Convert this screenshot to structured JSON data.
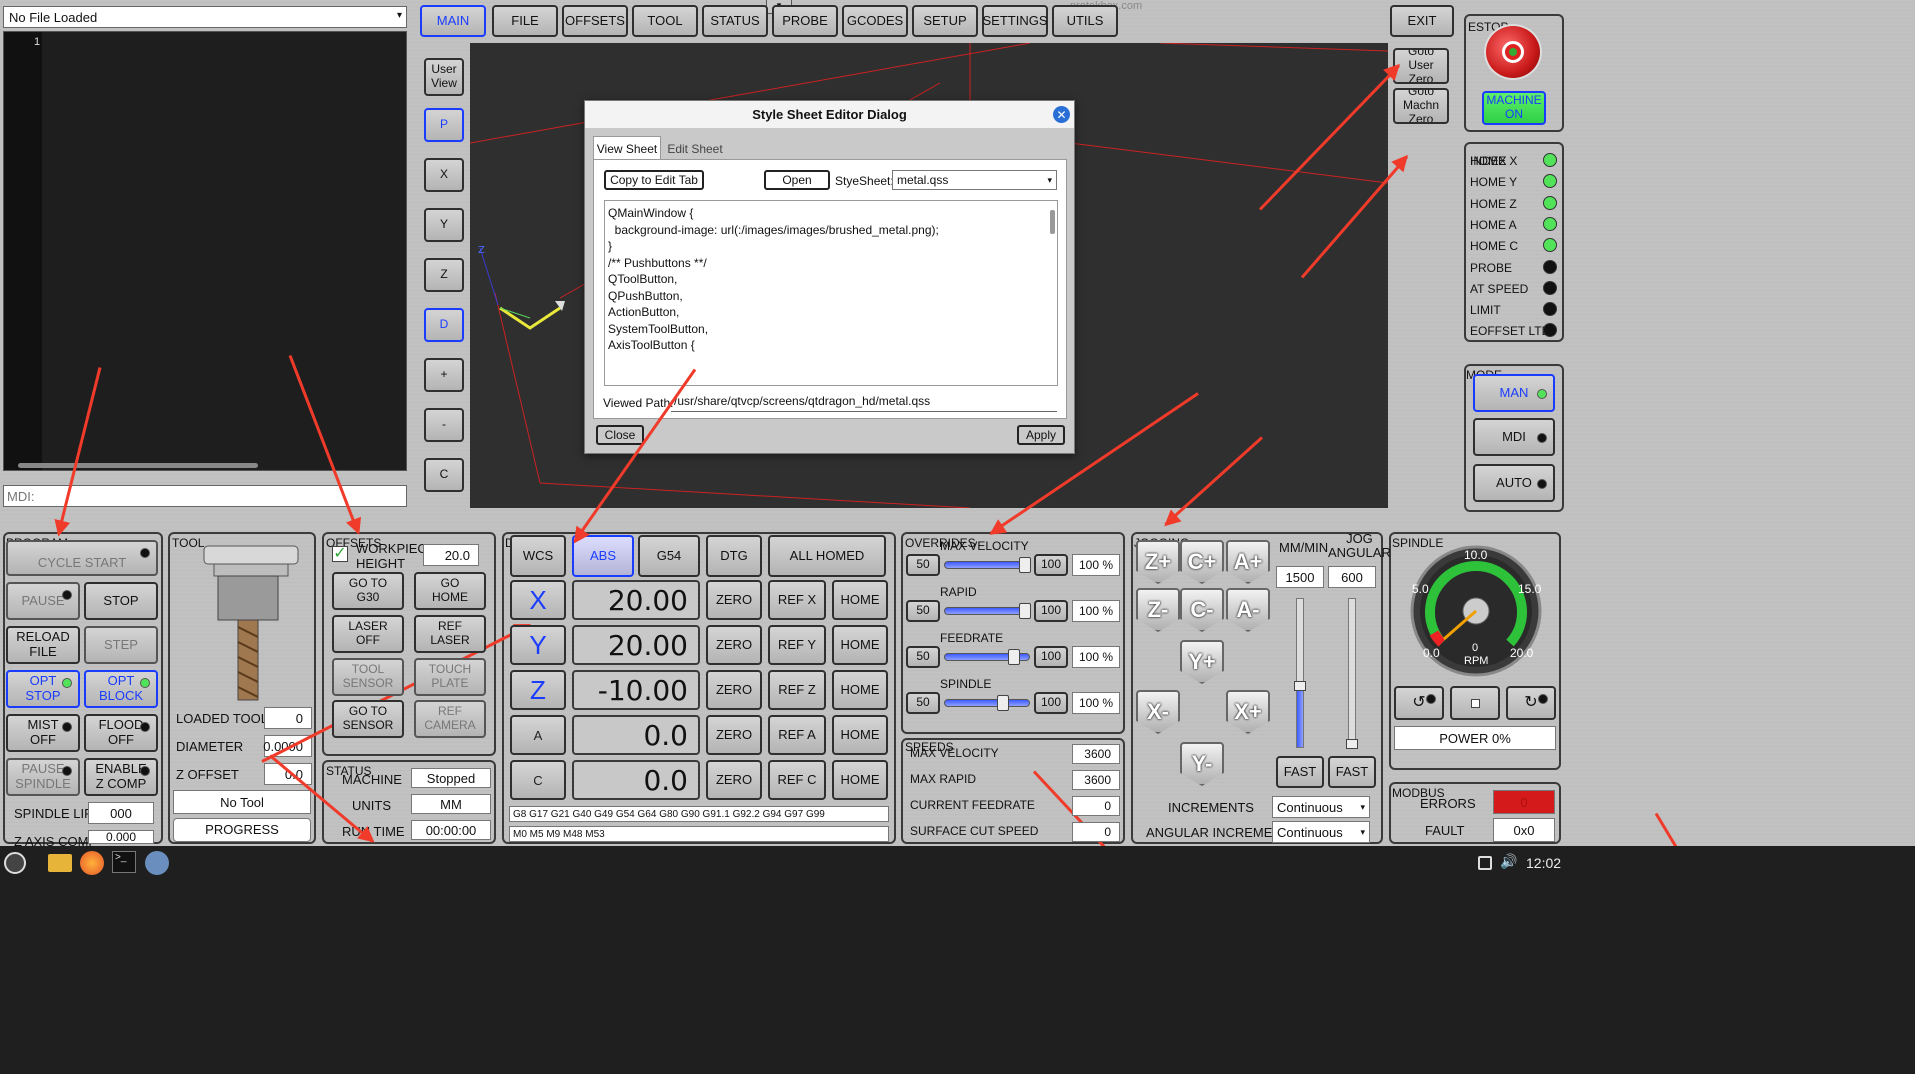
{
  "file_selector": {
    "value": "No File Loaded"
  },
  "editor": {
    "line_number": "1"
  },
  "mdi": {
    "placeholder": "MDI:"
  },
  "tabs": [
    "MAIN",
    "FILE",
    "OFFSETS",
    "TOOL",
    "STATUS",
    "PROBE",
    "GCODES",
    "SETUP",
    "SETTINGS",
    "UTILS"
  ],
  "exit_label": "EXIT",
  "view_buttons": [
    "User\nView",
    "P",
    "X",
    "Y",
    "Z",
    "D",
    "+",
    "-",
    "C"
  ],
  "goto_buttons": [
    "Goto\nUser\nZero",
    "Goto\nMachn\nZero"
  ],
  "watermark": "protekbox.com",
  "dialog": {
    "title": "Style Sheet Editor Dialog",
    "tabs": [
      "View Sheet",
      "Edit Sheet"
    ],
    "copy_button": "Copy to Edit Tab",
    "open_button": "Open",
    "stylesheet_label": "StyeSheet:",
    "stylesheet_value": "metal.qss",
    "code_lines": [
      "QMainWindow {",
      "  background-image: url(:/images/images/brushed_metal.png);",
      "}",
      "",
      "",
      "/** Pushbuttons **/",
      "QToolButton,",
      "QPushButton,",
      "ActionButton,",
      "SystemToolButton,",
      "AxisToolButton {"
    ],
    "path_label": "Viewed Path:",
    "path_value": "/usr/share/qtvcp/screens/qtdragon_hd/metal.qss",
    "close_button": "Close",
    "apply_button": "Apply"
  },
  "estop": {
    "title": "ESTOP",
    "machine_on": "MACHINE\nON"
  },
  "homing": [
    {
      "label": "HOME X",
      "on": true
    },
    {
      "label": "HOME Y",
      "on": true
    },
    {
      "label": "HOME Z",
      "on": true
    },
    {
      "label": "HOME A",
      "on": true
    },
    {
      "label": "HOME C",
      "on": true
    },
    {
      "label": "PROBE",
      "on": false
    },
    {
      "label": "AT SPEED",
      "on": false
    },
    {
      "label": "LIMIT",
      "on": false
    },
    {
      "label": "EOFFSET LTD",
      "on": false
    }
  ],
  "homing_overlap": "INDEX",
  "mode": {
    "title": "MODE",
    "buttons": [
      "MAN",
      "MDI",
      "AUTO"
    ]
  },
  "program": {
    "title": "PROGRAM",
    "cycle_start": "CYCLE START",
    "pause": "PAUSE",
    "stop": "STOP",
    "reload": "RELOAD\nFILE",
    "step": "STEP",
    "opt_stop": "OPT\nSTOP",
    "opt_block": "OPT\nBLOCK",
    "mist": "MIST\nOFF",
    "flood": "FLOOD\nOFF",
    "pause_spindle": "PAUSE\nSPINDLE",
    "enable_zcomp": "ENABLE\nZ COMP",
    "spindle_lift_label": "SPINDLE LIFT",
    "spindle_lift_value": "000",
    "zaxis_comp_label": "Z AXIS COMP",
    "zaxis_comp_value": "0.000"
  },
  "tool": {
    "title": "TOOL",
    "loaded_tool_label": "LOADED TOOL",
    "loaded_tool_value": "0",
    "diameter_label": "DIAMETER",
    "diameter_value": "0.0000",
    "zoffset_label": "Z OFFSET",
    "zoffset_value": "0.0",
    "tool_name": "No Tool",
    "progress": "PROGRESS"
  },
  "offsets": {
    "title": "OFFSETS",
    "workpiece_label": "WORKPIECE\nHEIGHT",
    "workpiece_value": "20.0",
    "buttons": [
      "GO TO\nG30",
      "GO\nHOME",
      "LASER\nOFF",
      "REF\nLASER",
      "TOOL\nSENSOR",
      "TOUCH\nPLATE",
      "GO TO\nSENSOR",
      "REF\nCAMERA"
    ]
  },
  "status": {
    "title": "STATUS",
    "machine_label": "MACHINE",
    "machine_value": "Stopped",
    "units_label": "UNITS",
    "units_value": "MM",
    "runtime_label": "RUN TIME",
    "runtime_value": "00:00:00"
  },
  "dro": {
    "title": "DRO",
    "wcs": "WCS",
    "abs": "ABS",
    "g54": "G54",
    "dtg": "DTG",
    "all_homed": "ALL HOMED",
    "axes": [
      {
        "axis": "X",
        "value": "20.00",
        "ref": "REF X"
      },
      {
        "axis": "Y",
        "value": "20.00",
        "ref": "REF Y"
      },
      {
        "axis": "Z",
        "value": "-10.00",
        "ref": "REF Z"
      },
      {
        "axis": "A",
        "value": "0.0",
        "ref": "REF A"
      },
      {
        "axis": "C",
        "value": "0.0",
        "ref": "REF C"
      }
    ],
    "zero": "ZERO",
    "home": "HOME",
    "gcodes": "G8 G17 G21 G40 G49 G54 G64 G80 G90 G91.1 G92.2 G94 G97 G99",
    "mcodes": "M0 M5 M9 M48 M53"
  },
  "overrides": {
    "title": "OVERRIDES",
    "rows": [
      {
        "label": "MAX VELOCITY",
        "min": "50",
        "max": "100",
        "value": "100 %",
        "level": 1.0
      },
      {
        "label": "RAPID",
        "min": "50",
        "max": "100",
        "value": "100 %",
        "level": 1.0
      },
      {
        "label": "FEEDRATE",
        "min": "50",
        "max": "100",
        "value": "100 %",
        "level": 0.85
      },
      {
        "label": "SPINDLE",
        "min": "50",
        "max": "100",
        "value": "100 %",
        "level": 0.7
      }
    ]
  },
  "speeds": {
    "title": "SPEEDS",
    "rows": [
      {
        "label": "MAX VELOCITY",
        "value": "3600"
      },
      {
        "label": "MAX RAPID",
        "value": "3600"
      },
      {
        "label": "CURRENT FEEDRATE",
        "value": "0"
      },
      {
        "label": "SURFACE CUT SPEED",
        "value": "0"
      }
    ]
  },
  "jogging": {
    "title": "JOGGING",
    "buttons": [
      "Z+",
      "C+",
      "A+",
      "Z-",
      "C-",
      "A-",
      "Y+",
      "X-",
      "X+",
      "Y-"
    ],
    "mm_min_label": "MM/MIN",
    "jog_angular_label": "JOG\nANGULAR",
    "mm_min_value": "1500",
    "angular_value": "600",
    "fast": "FAST",
    "increments_label": "INCREMENTS",
    "increments_value": "Continuous",
    "angular_inc_label": "ANGULAR INCREMENT",
    "angular_inc_value": "Continuous"
  },
  "spindle": {
    "title": "SPINDLE",
    "gauge_labels": [
      "0.0",
      "5.0",
      "10.0",
      "15.0",
      "20.0"
    ],
    "rpm_value": "0",
    "rpm_label": "RPM",
    "power": "POWER 0%"
  },
  "modbus": {
    "title": "MODBUS",
    "errors_label": "ERRORS",
    "errors_value": "0",
    "fault_label": "FAULT",
    "fault_value": "0x0"
  },
  "taskbar": {
    "time": "12:02"
  },
  "colors": {
    "accent": "#1a3cff",
    "led_on": "#53e35a",
    "arrow": "#f03a2a",
    "viewport": "#2f2f2f"
  }
}
